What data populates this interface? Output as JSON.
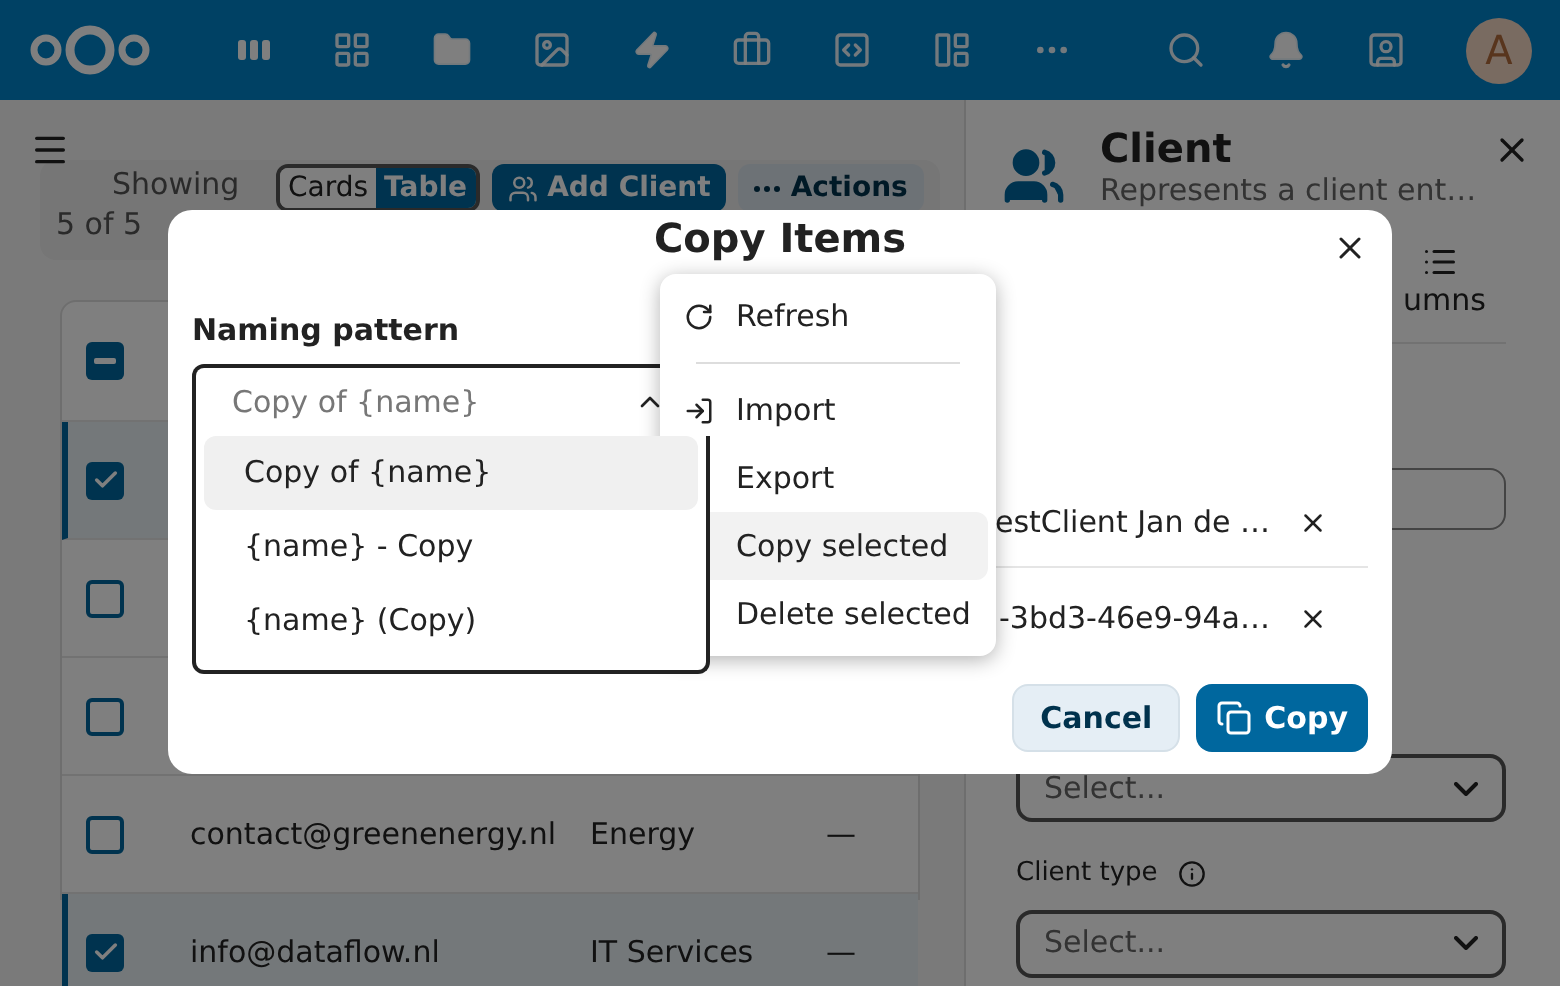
{
  "nav": {
    "avatar_initial": "A"
  },
  "toolbar": {
    "showing": "Showing",
    "count": "5 of 5",
    "views": [
      {
        "label": "Cards",
        "selected": false
      },
      {
        "label": "Table",
        "selected": true
      }
    ],
    "add_button": "Add Client",
    "actions_button": "Actions"
  },
  "table": {
    "header_checkbox": {
      "checked": true,
      "partial": true
    },
    "rows": [
      {
        "checked": true
      },
      {
        "checked": false
      },
      {
        "checked": false
      },
      {
        "checked": false,
        "cells": [
          "contact@greenenergy.nl",
          "Energy",
          "—"
        ]
      },
      {
        "checked": true,
        "cells": [
          "info@dataflow.nl",
          "IT Services",
          "—"
        ]
      }
    ]
  },
  "sidebar": {
    "title": "Client",
    "subtitle": "Represents a client ent…",
    "tab_label": "umns",
    "fields": [
      {
        "kind": "input"
      },
      {
        "kind": "select",
        "placeholder": "Select..."
      },
      {
        "kind": "select",
        "label": "Client type",
        "placeholder": "Select..."
      }
    ]
  },
  "modal": {
    "title": "Copy Items",
    "field_label": "Naming pattern",
    "select": {
      "placeholder": "Copy of {name}",
      "options": [
        {
          "label": "Copy of {name}",
          "selected": true
        },
        {
          "label": "{name} - Copy",
          "selected": false
        },
        {
          "label": "{name} (Copy)",
          "selected": false
        }
      ]
    },
    "items": [
      {
        "name": "estClient Jan de …"
      },
      {
        "name": "-3bd3-46e9-94a…"
      }
    ],
    "buttons": [
      {
        "label": "Cancel",
        "kind": "secondary"
      },
      {
        "label": "Copy",
        "kind": "primary"
      }
    ]
  },
  "menu": {
    "items": [
      {
        "kind": "item",
        "label": "Refresh",
        "selected": false
      },
      {
        "kind": "separator"
      },
      {
        "kind": "item",
        "label": "Import",
        "selected": false
      },
      {
        "kind": "item",
        "label": "Export",
        "selected": false
      },
      {
        "kind": "item",
        "label": "Copy selected",
        "selected": true
      },
      {
        "kind": "item",
        "label": "Delete selected",
        "selected": false
      }
    ]
  }
}
